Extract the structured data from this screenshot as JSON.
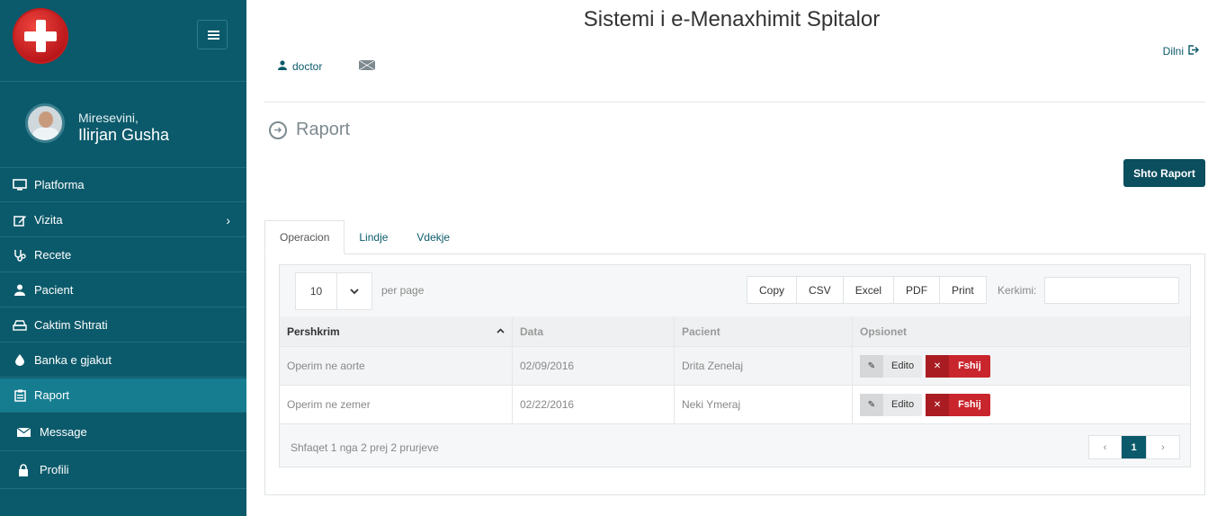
{
  "app": {
    "title": "Sistemi i e-Menaxhimit Spitalor"
  },
  "sidebar": {
    "welcome": "Miresevini,",
    "username": "Ilirjan Gusha",
    "items": [
      {
        "label": "Platforma",
        "icon": "monitor-icon",
        "active": false
      },
      {
        "label": "Vizita",
        "icon": "edit-icon",
        "active": false,
        "has_submenu": true
      },
      {
        "label": "Recete",
        "icon": "stethoscope-icon",
        "active": false
      },
      {
        "label": "Pacient",
        "icon": "user-icon",
        "active": false
      },
      {
        "label": "Caktim Shtrati",
        "icon": "bed-icon",
        "active": false
      },
      {
        "label": "Banka e gjakut",
        "icon": "drop-icon",
        "active": false
      },
      {
        "label": "Raport",
        "icon": "report-icon",
        "active": true
      },
      {
        "label": "Message",
        "icon": "envelope-icon",
        "active": false
      },
      {
        "label": "Profili",
        "icon": "lock-icon",
        "active": false
      }
    ]
  },
  "topbar": {
    "user": "doctor",
    "logout": "Dilni"
  },
  "page": {
    "title": "Raport",
    "add_button": "Shto Raport"
  },
  "tabs": [
    {
      "label": "Operacion",
      "active": true
    },
    {
      "label": "Lindje",
      "active": false
    },
    {
      "label": "Vdekje",
      "active": false
    }
  ],
  "table_controls": {
    "per_page_value": "10",
    "per_page_label": "per page",
    "export_buttons": [
      "Copy",
      "CSV",
      "Excel",
      "PDF",
      "Print"
    ],
    "search_label": "Kerkimi:",
    "search_value": ""
  },
  "table": {
    "columns": [
      "Pershkrim",
      "Data",
      "Pacient",
      "Opsionet"
    ],
    "rows": [
      {
        "pershkrim": "Operim ne aorte",
        "data": "02/09/2016",
        "pacient": "Drita Zenelaj"
      },
      {
        "pershkrim": "Operim ne zemer",
        "data": "02/22/2016",
        "pacient": "Neki Ymeraj"
      }
    ],
    "edit_label": "Edito",
    "delete_label": "Fshij"
  },
  "footer": {
    "info": "Shfaqet 1 nga 2 prej 2 prurjeve",
    "pages": [
      "‹",
      "1",
      "›"
    ]
  },
  "colors": {
    "sidebar": "#0b5a6b",
    "active": "#167d90",
    "danger": "#c9252c"
  }
}
